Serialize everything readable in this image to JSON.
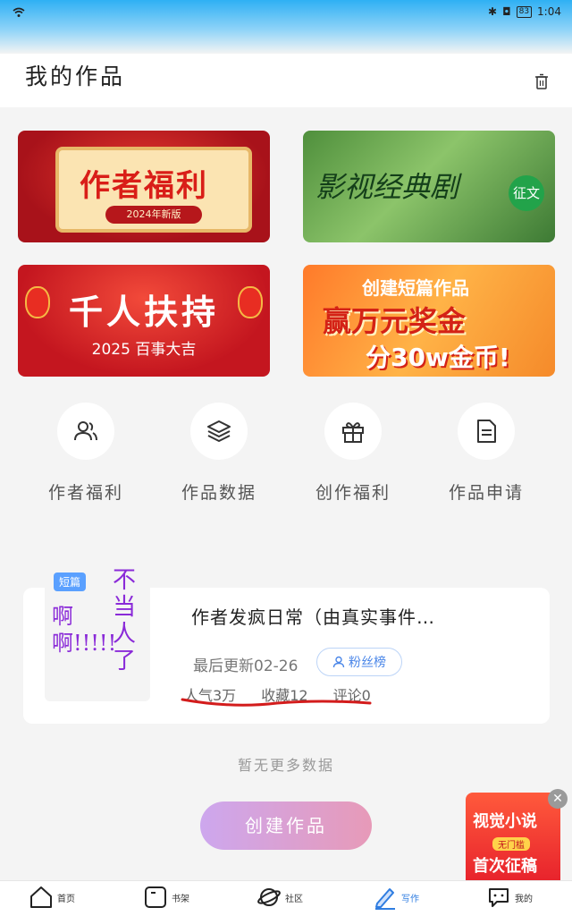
{
  "status": {
    "battery": "83",
    "time": "1:04"
  },
  "header": {
    "title": "我的作品"
  },
  "banners": [
    {
      "title": "作者福利",
      "subtitle": "2024年新版"
    },
    {
      "title": "影视经典剧",
      "tag": "征文"
    },
    {
      "title": "千人扶持",
      "subtitle": "2025 百事大吉"
    },
    {
      "line1": "创建短篇作品",
      "line2": "赢万元奖金",
      "line3": "分30w金币!"
    }
  ],
  "quick_actions": [
    {
      "label": "作者福利",
      "icon": "person-group-icon"
    },
    {
      "label": "作品数据",
      "icon": "layers-icon"
    },
    {
      "label": "创作福利",
      "icon": "gift-icon"
    },
    {
      "label": "作品申请",
      "icon": "document-icon"
    }
  ],
  "work": {
    "badge": "短篇",
    "cover_text": [
      "不当人了",
      "啊啊!!!!!"
    ],
    "title": "作者发疯日常（由真实事件…",
    "updated": "最后更新02-26",
    "fans_label": "粉丝榜",
    "stats": {
      "popularity": "人气3万",
      "favorites": "收藏12",
      "comments": "评论0"
    }
  },
  "no_more": "暂无更多数据",
  "create_button": "创建作品",
  "float_ad": {
    "line1": "视觉小说",
    "badge": "无门槛",
    "line2": "首次征稿"
  },
  "tabs": [
    {
      "label": "首页",
      "icon": "home-icon"
    },
    {
      "label": "书架",
      "icon": "bookshelf-icon"
    },
    {
      "label": "社区",
      "icon": "planet-icon"
    },
    {
      "label": "写作",
      "icon": "pen-icon",
      "active": true
    },
    {
      "label": "我的",
      "icon": "chat-bubble-icon"
    }
  ],
  "colors": {
    "accent": "#2f7de1",
    "create_gradient_start": "#cda7ee",
    "create_gradient_end": "#e79ab8",
    "annotation": "#d31c1c"
  }
}
